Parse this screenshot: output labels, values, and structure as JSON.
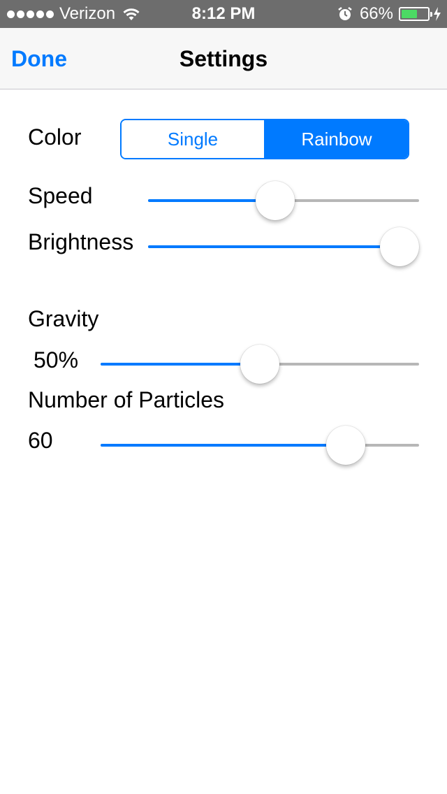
{
  "status_bar": {
    "signal_bars": 5,
    "carrier": "Verizon",
    "wifi_icon": "wifi-icon",
    "time": "8:12 PM",
    "alarm_icon": "alarm-clock-icon",
    "battery_percent": "66%",
    "battery_level": 0.66,
    "charging_icon": "lightning-bolt-icon"
  },
  "nav": {
    "done_label": "Done",
    "title": "Settings"
  },
  "settings": {
    "color": {
      "label": "Color",
      "options": [
        "Single",
        "Rainbow"
      ],
      "selected": "Rainbow"
    },
    "speed": {
      "label": "Speed",
      "value": 0.47
    },
    "brightness": {
      "label": "Brightness",
      "value": 1.0
    },
    "gravity": {
      "label": "Gravity",
      "value_text": "50%",
      "value": 0.5
    },
    "particles": {
      "label": "Number of Particles",
      "value_text": "60",
      "value": 0.77
    }
  },
  "colors": {
    "accent": "#007aff",
    "track": "#b7b7b7",
    "status_bar_bg": "#6d6d6d",
    "nav_bg": "#f7f7f7",
    "battery_green": "#4cd964"
  }
}
